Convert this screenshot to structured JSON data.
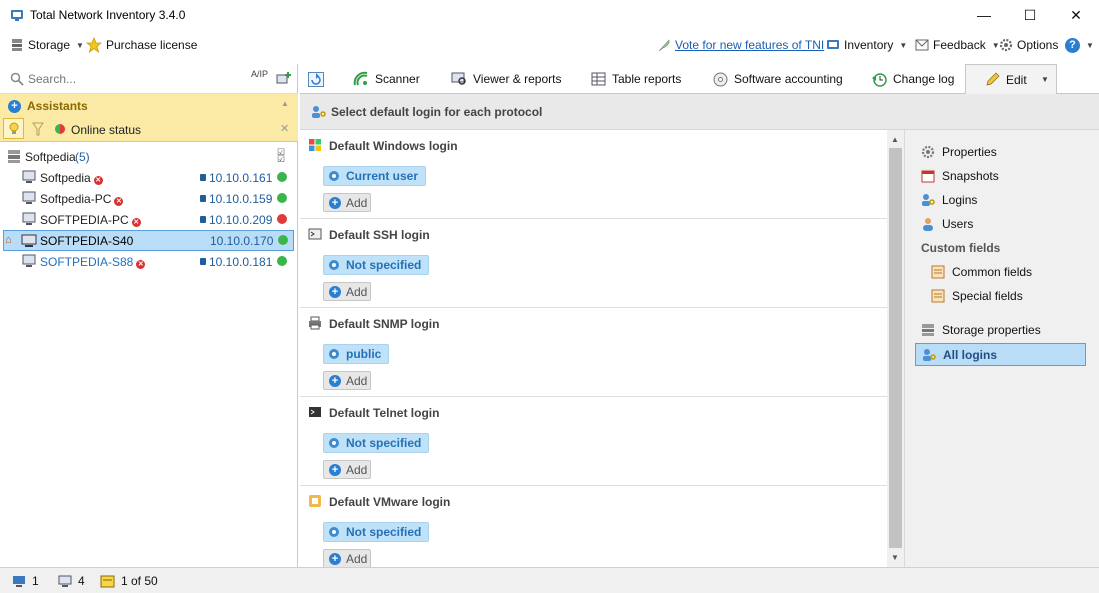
{
  "window": {
    "title": "Total Network Inventory 3.4.0",
    "controls": {
      "minimize": "—",
      "maximize": "☐",
      "close": "✕"
    }
  },
  "toolbar": {
    "storage": "Storage",
    "purchase": "Purchase license",
    "vote": "Vote for new features of TNI",
    "inventory": "Inventory",
    "feedback": "Feedback",
    "options": "Options",
    "help": "?"
  },
  "search": {
    "placeholder": "Search...",
    "sort_label": "A/IP"
  },
  "assistants": {
    "title": "Assistants",
    "online_status": "Online status"
  },
  "tree": {
    "root": {
      "name": "Softpedia",
      "count": "(5)"
    },
    "items": [
      {
        "name": "Softpedia",
        "ip": "10.10.0.161",
        "status": "online",
        "error": true
      },
      {
        "name": "Softpedia-PC",
        "ip": "10.10.0.159",
        "status": "online",
        "error": true
      },
      {
        "name": "SOFTPEDIA-PC",
        "ip": "10.10.0.209",
        "status": "offline",
        "error": true
      },
      {
        "name": "SOFTPEDIA-S40",
        "ip": "10.10.0.170",
        "status": "online",
        "error": false
      },
      {
        "name": "SOFTPEDIA-S88",
        "ip": "10.10.0.181",
        "status": "online",
        "error": true
      }
    ]
  },
  "tabs": {
    "scanner": "Scanner",
    "viewer": "Viewer & reports",
    "table_reports": "Table reports",
    "software": "Software accounting",
    "changelog": "Change log",
    "edit": "Edit"
  },
  "header": {
    "title": "Select default login for each protocol"
  },
  "sections": [
    {
      "title": "Default Windows login",
      "value": "Current user",
      "add": "Add"
    },
    {
      "title": "Default SSH login",
      "value": "Not specified",
      "add": "Add"
    },
    {
      "title": "Default SNMP login",
      "value": "public",
      "add": "Add"
    },
    {
      "title": "Default Telnet login",
      "value": "Not specified",
      "add": "Add"
    },
    {
      "title": "Default VMware login",
      "value": "Not specified",
      "add": "Add"
    }
  ],
  "right_panel": {
    "properties": "Properties",
    "snapshots": "Snapshots",
    "logins": "Logins",
    "users": "Users",
    "custom_fields": "Custom fields",
    "common_fields": "Common fields",
    "special_fields": "Special fields",
    "storage_properties": "Storage properties",
    "all_logins": "All logins"
  },
  "status": {
    "computers": "1",
    "nodes": "4",
    "page": "1 of 50"
  },
  "colors": {
    "accent": "#2b7fd1",
    "online": "#39b54a",
    "offline": "#e03b3b",
    "selection": "#b9dcf7",
    "assistants_bg": "#fbe9a6"
  }
}
